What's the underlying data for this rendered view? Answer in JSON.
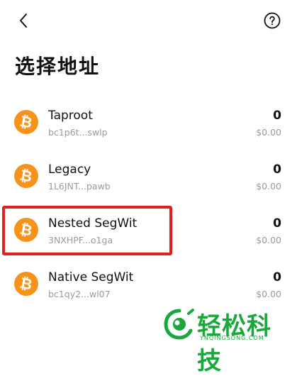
{
  "header": {
    "back_icon": "chevron-left-icon",
    "help_icon": "question-circle-icon",
    "title": "选择地址"
  },
  "addresses": [
    {
      "name": "Taproot",
      "address": "bc1p6t...swlp",
      "amount": "0",
      "fiat": "$0.00",
      "icon": "bitcoin-icon"
    },
    {
      "name": "Legacy",
      "address": "1L6JNT...pawb",
      "amount": "0",
      "fiat": "$0.00",
      "icon": "bitcoin-icon"
    },
    {
      "name": "Nested SegWit",
      "address": "3NXHPF...o1ga",
      "amount": "0",
      "fiat": "$0.00",
      "icon": "bitcoin-icon",
      "highlighted": true
    },
    {
      "name": "Native SegWit",
      "address": "bc1qy2...wl07",
      "amount": "0",
      "fiat": "$0.00",
      "icon": "bitcoin-icon"
    }
  ],
  "coin_glyph": "₿",
  "watermark": {
    "text": "轻松科技",
    "sub": "YNQINGSONG.COM"
  },
  "colors": {
    "bitcoin_orange": "#f7931a",
    "highlight_red": "#e02020",
    "watermark_green": "#1aa83c",
    "secondary_text": "#9a9a9a"
  }
}
